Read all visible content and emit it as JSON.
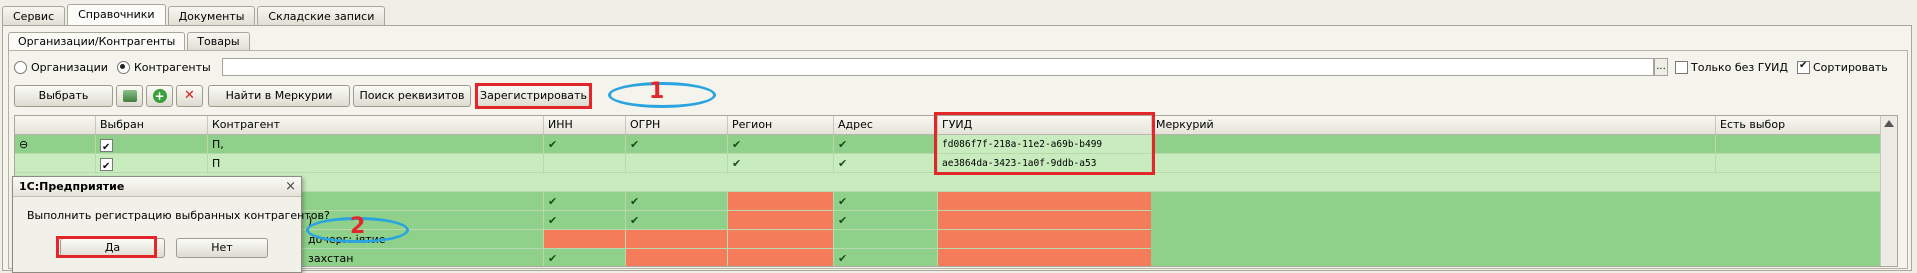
{
  "tabs": [
    "Сервис",
    "Справочники",
    "Документы",
    "Складские записи"
  ],
  "subtabs": [
    "Организации/Контрагенты",
    "Товары"
  ],
  "filter": {
    "radio_org": "Организации",
    "radio_contr": "Контрагенты",
    "search_value": "",
    "ellipsis": "...",
    "only_no_guid": "Только без ГУИД",
    "sort": "Сортировать"
  },
  "toolbar": {
    "select": "Выбрать",
    "find_mercury": "Найти в Меркурии",
    "search_details": "Поиск реквизитов",
    "register": "Зарегистрировать"
  },
  "table": {
    "headers": [
      "",
      "Выбран",
      "Контрагент",
      "ИНН",
      "ОГРН",
      "Регион",
      "Адрес",
      "ГУИД",
      "Меркурий",
      "Есть выбор"
    ],
    "rows": [
      {
        "marker": "⊖",
        "name": "П,",
        "guid": "fd086f7f-218a-11e2-a69b-b499"
      },
      {
        "marker": "",
        "name": "П",
        "guid": "ae3864da-3423-1a0f-9ddb-a53"
      },
      {
        "marker": "",
        "name": "",
        "guid": ""
      },
      {
        "marker": "",
        "name": "",
        "guid": ""
      },
      {
        "marker": "",
        "name": ")",
        "guid": ""
      },
      {
        "marker": "",
        "name": "дочерг:  іятие",
        "guid": ""
      },
      {
        "marker": "",
        "name": "захстан",
        "guid": ""
      }
    ]
  },
  "dialog": {
    "title": "1С:Предприятие",
    "close": "×",
    "message": "Выполнить регистрацию выбранных контрагентов?",
    "yes": "Да",
    "no": "Нет"
  },
  "annotations": {
    "one": "1",
    "two": "2"
  },
  "colors": {
    "green": "#8fd18a",
    "light_green": "#c8ecbe",
    "orange_red": "#f47c5a",
    "annotation_red": "#e3262a",
    "annotation_blue": "#2aa4e0"
  }
}
